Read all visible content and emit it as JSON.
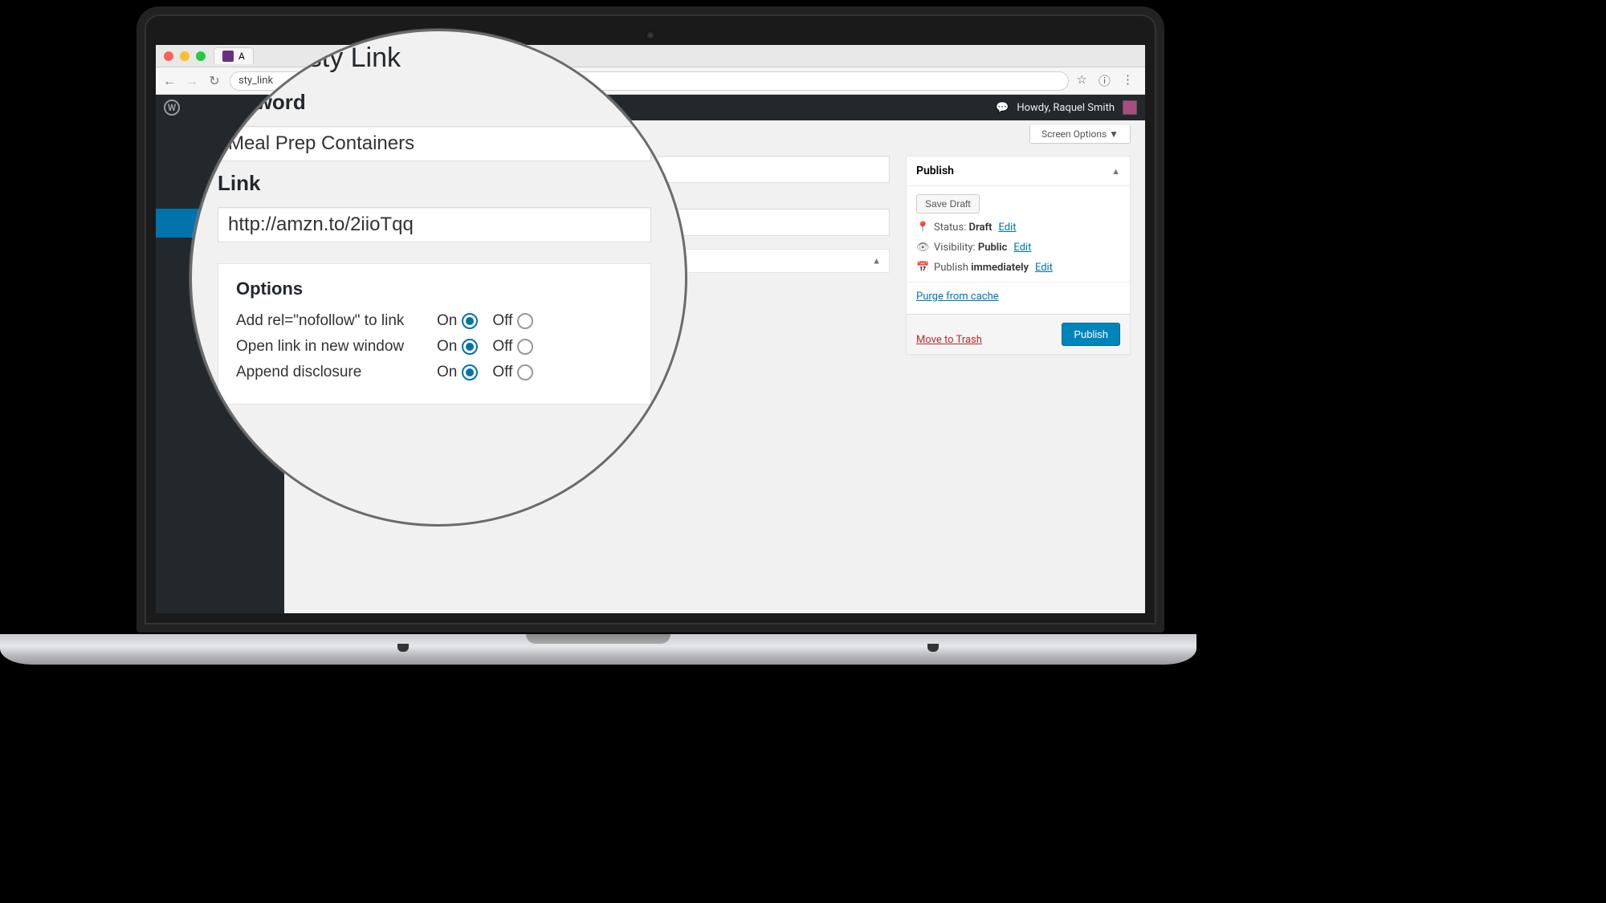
{
  "browser": {
    "tab_title": "A",
    "url": "sty_link"
  },
  "wp": {
    "howdy": "Howdy, Raquel Smith",
    "screen_options": "Screen Options ▼"
  },
  "zoom": {
    "page_title": "New Tasty Link",
    "keyword_label": "Keyword",
    "keyword_value": "Meal Prep Containers",
    "link_label": "Link",
    "link_value": "http://amzn.to/2iioTqq",
    "options_label": "Options",
    "opt_nofollow": "Add rel=\"nofollow\" to link",
    "opt_newwin": "Open link in new window",
    "opt_disclosure": "Append disclosure",
    "on": "On",
    "off": "Off"
  },
  "publish": {
    "heading": "Publish",
    "save_draft": "Save Draft",
    "status_label": "Status: ",
    "status_value": "Draft",
    "visibility_label": "Visibility: ",
    "visibility_value": "Public",
    "publish_label": "Publish ",
    "publish_value": "immediately",
    "edit": "Edit",
    "purge": "Purge from cache",
    "trash": "Move to Trash",
    "publish_btn": "Publish"
  }
}
